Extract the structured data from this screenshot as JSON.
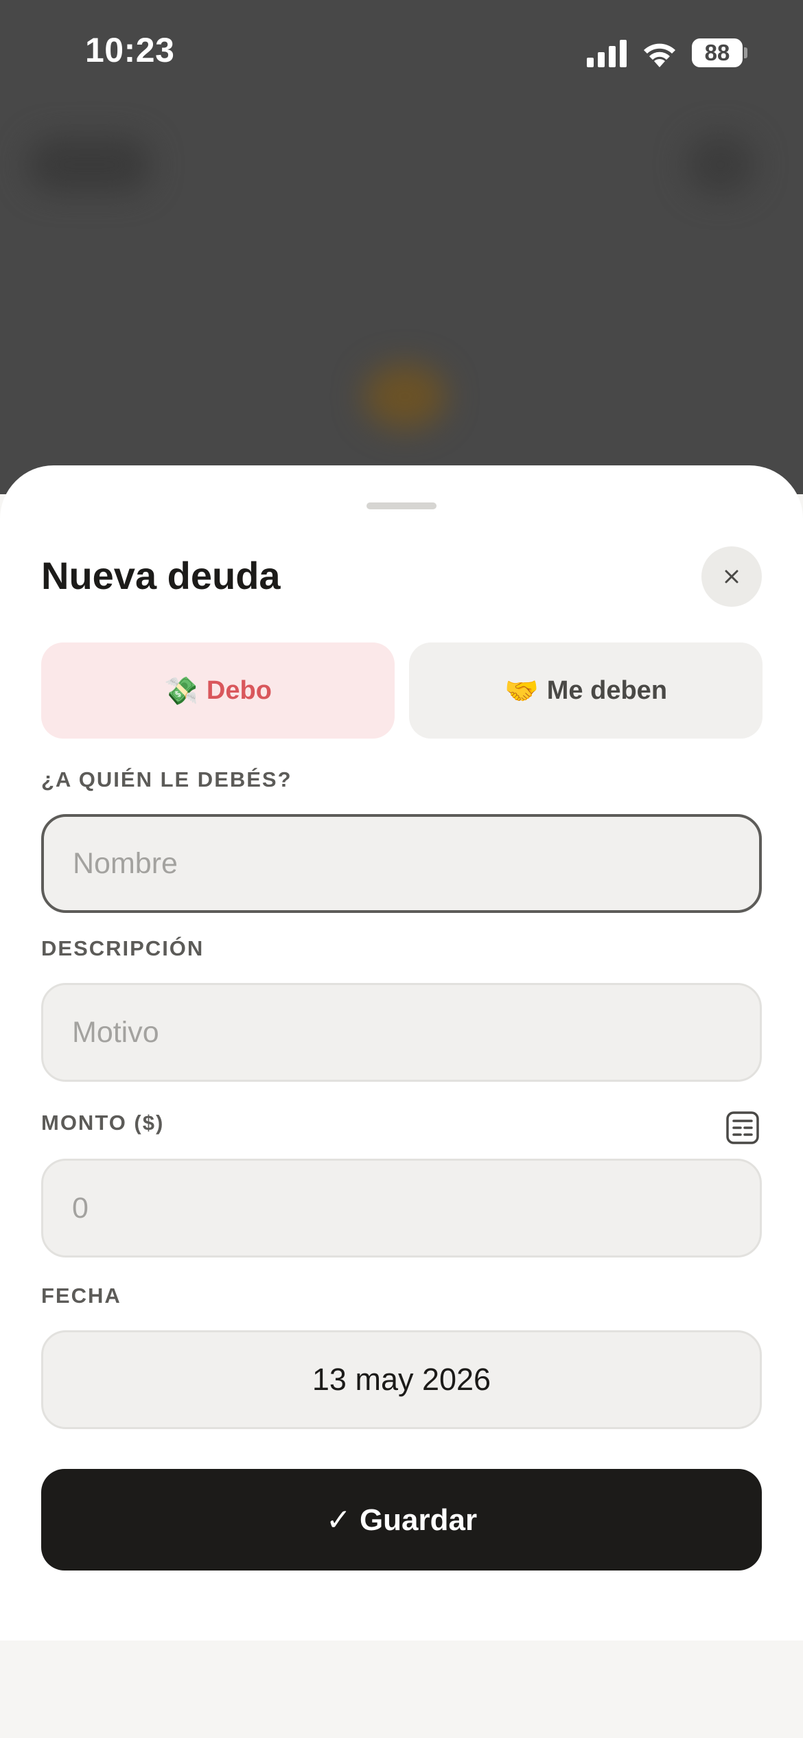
{
  "status_bar": {
    "time": "10:23",
    "battery_level": "88",
    "icons": [
      "signal-icon",
      "wifi-icon",
      "battery-icon"
    ]
  },
  "sheet": {
    "title": "Nueva deuda",
    "close_icon": "close-icon",
    "toggle": {
      "options": [
        {
          "emoji": "💸",
          "label": "Debo",
          "selected": true
        },
        {
          "emoji": "🤝",
          "label": "Me deben",
          "selected": false
        }
      ]
    },
    "fields": {
      "person": {
        "label": "¿A QUIÉN LE DEBÉS?",
        "placeholder": "Nombre",
        "value": ""
      },
      "description": {
        "label": "DESCRIPCIÓN",
        "placeholder": "Motivo",
        "value": ""
      },
      "amount": {
        "label": "MONTO ($)",
        "placeholder": "0",
        "value": "",
        "icon": "calculator-icon"
      },
      "date": {
        "label": "FECHA",
        "value": "13 may 2026"
      }
    },
    "save_label": "✓ Guardar"
  },
  "colors": {
    "accent_debt": "#d9575c",
    "accent_debt_bg": "#fbe8e9",
    "primary_button": "#1c1b19",
    "backdrop": "#484848"
  }
}
